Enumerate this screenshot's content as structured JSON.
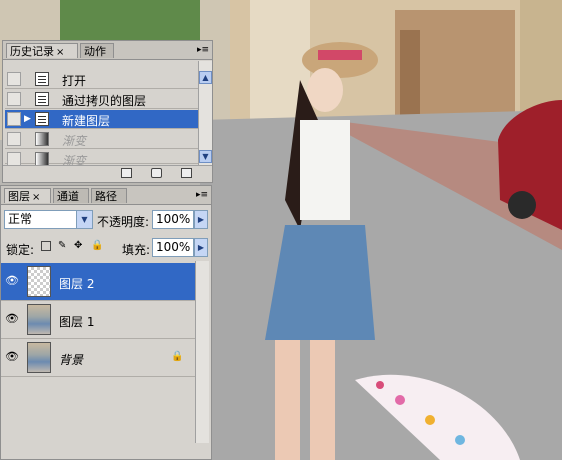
{
  "history_panel": {
    "tabs": [
      {
        "label": "历史记录",
        "close": "×"
      },
      {
        "label": "动作"
      }
    ],
    "menu_icon": "panel-menu-icon",
    "items": [
      {
        "label": "打开",
        "state": "normal"
      },
      {
        "label": "通过拷贝的图层",
        "state": "normal"
      },
      {
        "label": "新建图层",
        "state": "selected"
      },
      {
        "label": "渐变",
        "state": "disabled"
      },
      {
        "label": "渐变",
        "state": "disabled"
      }
    ]
  },
  "layers_panel": {
    "tabs": [
      {
        "label": "图层",
        "close": "×"
      },
      {
        "label": "通道"
      },
      {
        "label": "路径"
      }
    ],
    "blend_mode": "正常",
    "opacity_label": "不透明度:",
    "opacity_value": "100%",
    "lock_label": "锁定:",
    "fill_label": "填充:",
    "fill_value": "100%",
    "layers": [
      {
        "name": "图层 2",
        "selected": true,
        "thumbnail": "transparent"
      },
      {
        "name": "图层 1",
        "selected": false,
        "thumbnail": "photo"
      },
      {
        "name": "背景",
        "selected": false,
        "thumbnail": "photo",
        "locked": true
      }
    ]
  },
  "colors": {
    "selection": "#3168c5",
    "panel_bg": "#d6d3ce"
  }
}
